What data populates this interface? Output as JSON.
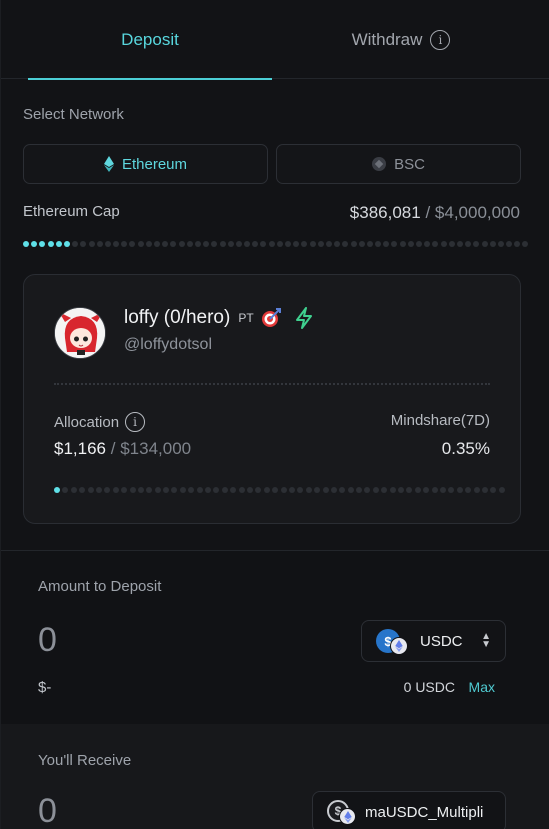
{
  "tabs": {
    "deposit": "Deposit",
    "withdraw": "Withdraw",
    "info_icon": "info-icon"
  },
  "network": {
    "label": "Select Network",
    "options": [
      {
        "label": "Ethereum",
        "icon": "ethereum-icon",
        "selected": true
      },
      {
        "label": "BSC",
        "icon": "bsc-icon",
        "selected": false
      }
    ]
  },
  "cap": {
    "label": "Ethereum Cap",
    "current": "$386,081",
    "separator": "/",
    "max": "$4,000,000",
    "progress_fraction": 0.0965
  },
  "profile": {
    "name": "loffy (0/hero)",
    "badge": "PT",
    "handle": "@loffydotsol",
    "badge_icons": [
      "target-icon",
      "lightning-icon"
    ],
    "allocation_label": "Allocation",
    "allocation_current": "$1,166",
    "allocation_separator": "/",
    "allocation_max": "$134,000",
    "allocation_fraction": 0.0087,
    "mindshare_label": "Mindshare(7D)",
    "mindshare_value": "0.35%"
  },
  "deposit": {
    "label": "Amount to Deposit",
    "amount": "0",
    "token": "USDC",
    "usd_value": "$-",
    "balance": "0 USDC",
    "max_label": "Max"
  },
  "receive": {
    "label": "You'll Receive",
    "amount": "0",
    "token": "maUSDC_Multipli"
  },
  "colors": {
    "accent": "#58d6dd",
    "background": "#121316",
    "card": "#18191c",
    "lightning": "#3fd08f"
  }
}
